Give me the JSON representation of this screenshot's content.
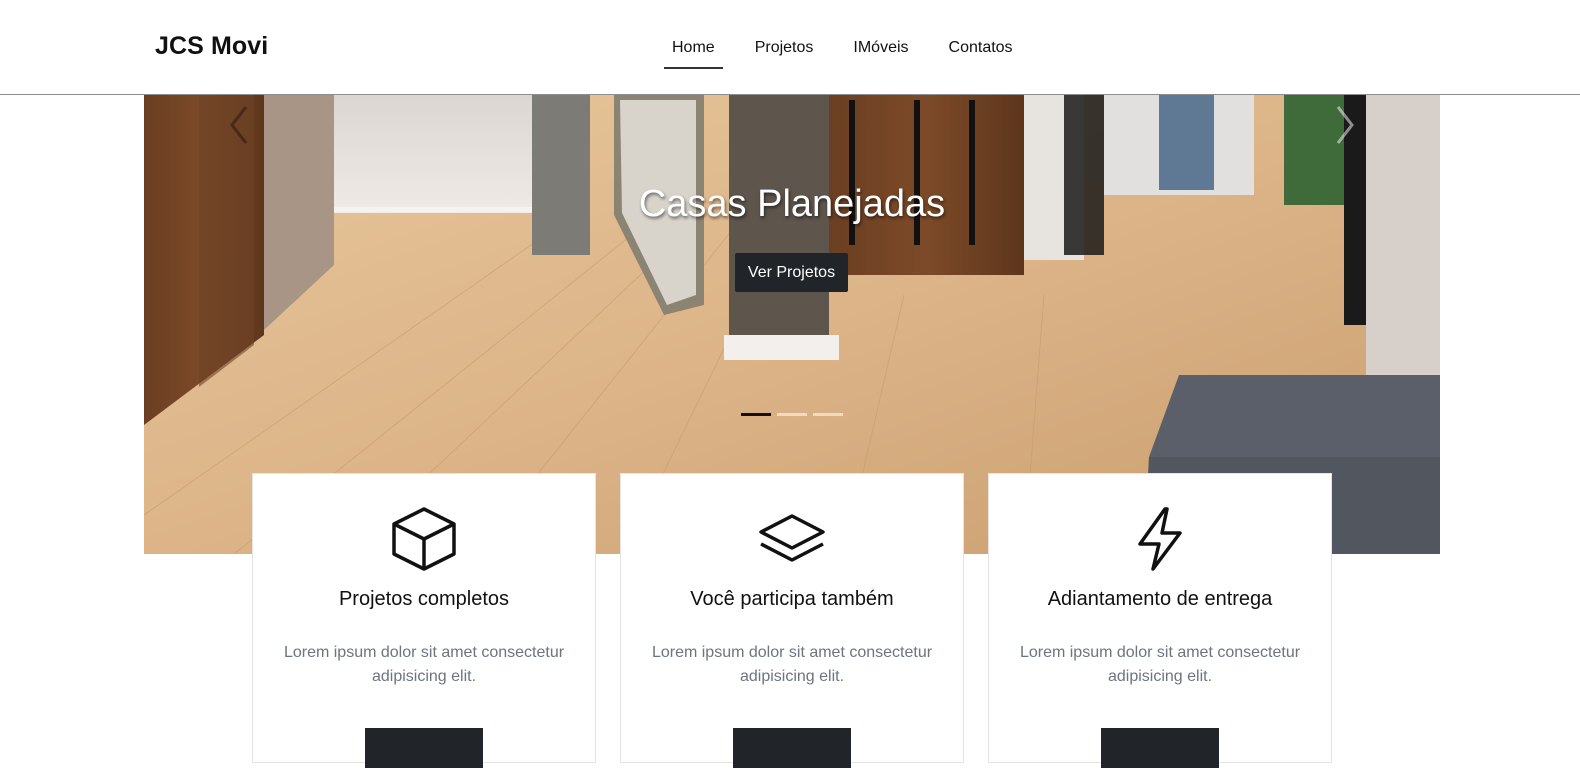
{
  "brand": {
    "name": "JCS Movi"
  },
  "nav": {
    "items": [
      {
        "label": "Home",
        "active": true
      },
      {
        "label": "Projetos",
        "active": false
      },
      {
        "label": "IMóveis",
        "active": false
      },
      {
        "label": "Contatos",
        "active": false
      }
    ]
  },
  "hero": {
    "title": "Casas Planejadas",
    "button_label": "Ver Projetos",
    "slide_count": 3,
    "active_slide": 1,
    "prev_icon": "chevron-left-icon",
    "next_icon": "chevron-right-icon"
  },
  "features": [
    {
      "icon": "box-icon",
      "title": "Projetos completos",
      "text": "Lorem ipsum dolor sit amet consectetur adipisicing elit."
    },
    {
      "icon": "layers-icon",
      "title": "Você participa também",
      "text": "Lorem ipsum dolor sit amet consectetur adipisicing elit."
    },
    {
      "icon": "lightning-icon",
      "title": "Adiantamento de entrega",
      "text": "Lorem ipsum dolor sit amet consectetur adipisicing elit."
    }
  ],
  "colors": {
    "dark": "#212529",
    "muted_text": "#6c757d",
    "floor": "#d9b287"
  }
}
